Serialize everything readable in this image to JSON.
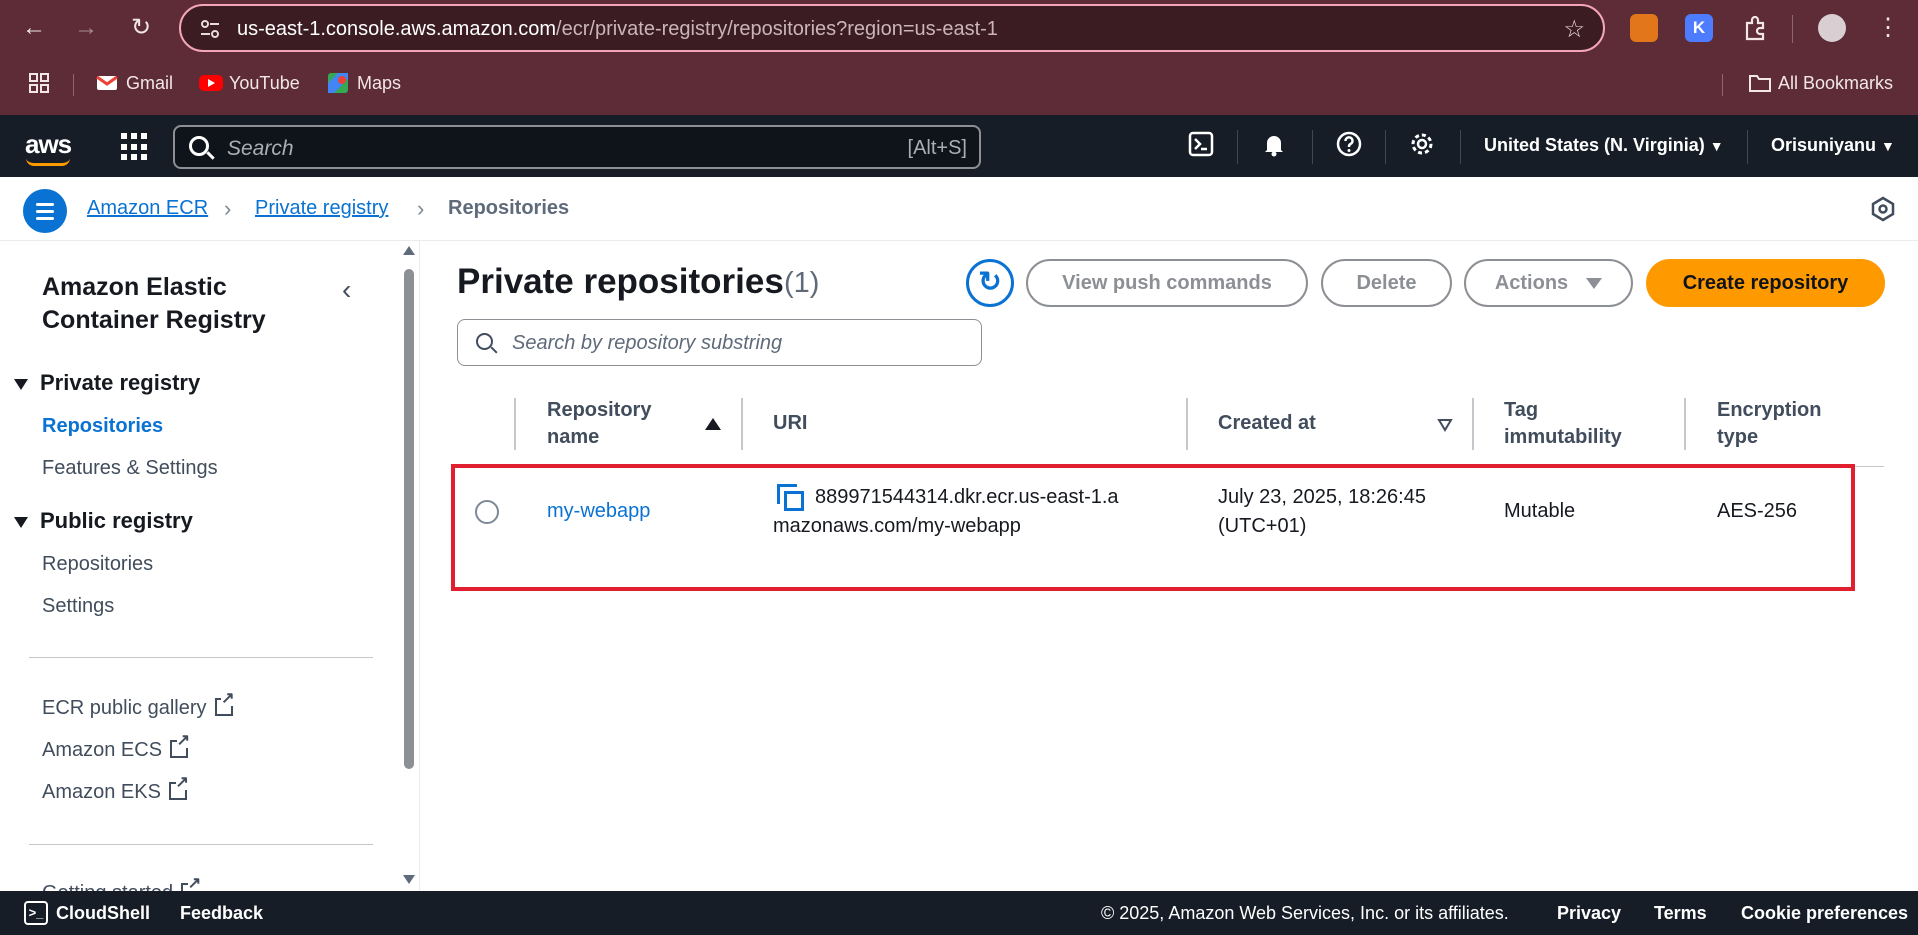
{
  "browser": {
    "back_icon": "←",
    "forward_icon": "→",
    "reload_icon": "↻",
    "url_host": "us-east-1.console.aws.amazon.com",
    "url_path": "/ecr/private-registry/repositories?region=us-east-1",
    "star_icon": "☆",
    "menu_icon": "⋮",
    "bookmarks": [
      {
        "label": "Gmail"
      },
      {
        "label": "YouTube"
      },
      {
        "label": "Maps"
      }
    ],
    "all_bookmarks": "All Bookmarks"
  },
  "aws_header": {
    "logo": "aws",
    "search_placeholder": "Search",
    "search_shortcut": "[Alt+S]",
    "region": "United States (N. Virginia)",
    "account": "Orisuniyanu",
    "region_caret": "▼",
    "account_caret": "▼"
  },
  "breadcrumb": {
    "items": [
      {
        "label": "Amazon ECR"
      },
      {
        "label": "Private registry"
      },
      {
        "label": "Repositories"
      }
    ],
    "separator": "›"
  },
  "sidebar": {
    "title": "Amazon Elastic Container Registry",
    "collapse_icon": "‹",
    "sections": [
      {
        "label": "Private registry",
        "items": [
          "Repositories",
          "Features & Settings"
        ]
      },
      {
        "label": "Public registry",
        "items": [
          "Repositories",
          "Settings"
        ]
      }
    ],
    "external_links": [
      "ECR public gallery",
      "Amazon ECS",
      "Amazon EKS"
    ],
    "cut_off_item": "Getting started"
  },
  "main": {
    "title": "Private repositories",
    "count": "(1)",
    "refresh_icon": "↻",
    "buttons": {
      "view_push": "View push commands",
      "delete": "Delete",
      "actions": "Actions",
      "create": "Create repository"
    },
    "search_placeholder": "Search by repository substring",
    "columns": {
      "name_line1": "Repository",
      "name_line2": "name",
      "uri": "URI",
      "created": "Created at",
      "tag_line1": "Tag",
      "tag_line2": "immutability",
      "enc_line1": "Encryption",
      "enc_line2": "type"
    },
    "rows": [
      {
        "name": "my-webapp",
        "uri_line1": "889971544314.dkr.ecr.us-east-1.a",
        "uri_line2": "mazonaws.com/my-webapp",
        "created_line1": "July 23, 2025, 18:26:45",
        "created_line2": "(UTC+01)",
        "tag_immutability": "Mutable",
        "encryption": "AES-256"
      }
    ]
  },
  "footer": {
    "cloudshell": "CloudShell",
    "feedback": "Feedback",
    "copyright": "© 2025, Amazon Web Services, Inc. or its affiliates.",
    "privacy": "Privacy",
    "terms": "Terms",
    "cookies": "Cookie preferences"
  },
  "colors": {
    "accent": "#0972d3",
    "primary_button": "#ff9900",
    "highlight": "#e0202e",
    "header_bg": "#161d26",
    "chrome_bg": "#5d2c36"
  }
}
